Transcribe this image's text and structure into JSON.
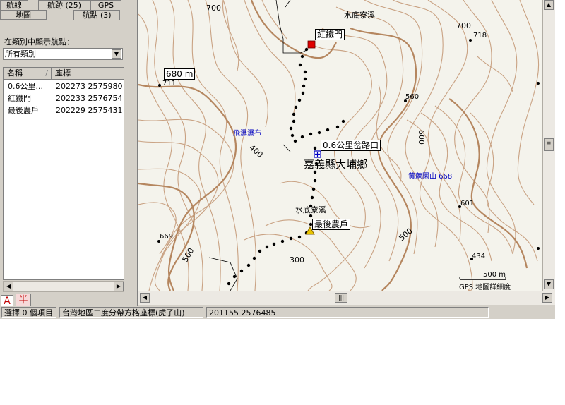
{
  "tabs": {
    "row1": [
      "航線",
      "航跡 (25)",
      "GPS"
    ],
    "row2": [
      "地圖",
      "航點 (3)"
    ]
  },
  "waypoint_panel": {
    "category_label": "在類別中顯示航點：",
    "category_value": "所有類別",
    "columns": [
      "名稱",
      "座標"
    ],
    "rows": [
      {
        "name": "0.6公里...",
        "coord": "202273 2575980"
      },
      {
        "name": "紅鐵門",
        "coord": "202233 2576754"
      },
      {
        "name": "最後農戶",
        "coord": "202229 2575431"
      }
    ]
  },
  "mode_buttons": {
    "a": "A",
    "b": "半"
  },
  "map": {
    "region_label": "嘉義縣大埔鄉",
    "place_labels": {
      "river_top": "水底寮溪",
      "river_mid": "水底寮溪",
      "waterfall": "飛瀑瀑布",
      "peak": "黃蘆園山 668"
    },
    "waypoints": {
      "gate": "紅鐵門",
      "junction": "0.6公里岔路口",
      "farm": "最後農戶"
    },
    "elevation_box": "680 m",
    "contour_labels": [
      "700",
      "700",
      "718",
      "711",
      "560",
      "600",
      "400",
      "601",
      "500",
      "669",
      "500",
      "300",
      "434"
    ],
    "scale": {
      "distance": "500 m",
      "caption": "GPS 地圖詳細度"
    }
  },
  "status_bar": {
    "selection": "選擇 0 個項目",
    "coordinate_system": "台灣地區二度分帶方格座標(虎子山)",
    "cursor_coords": "201155 2576485"
  },
  "colors": {
    "contour": "#c9a283",
    "contour_index": "#b5865f",
    "map_bg": "#f4f3ec",
    "track": "#000000",
    "gate_marker": "#e00000",
    "label_blue": "#0000c0",
    "chrome": "#d4d0c8"
  }
}
